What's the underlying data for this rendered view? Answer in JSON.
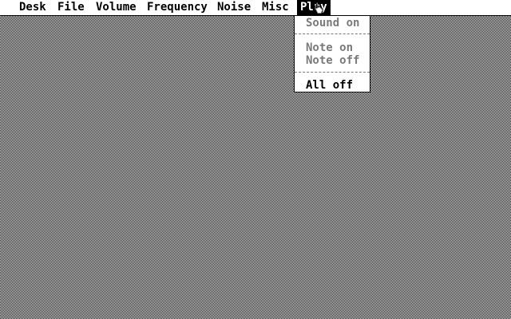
{
  "menubar": {
    "items": [
      {
        "label": "Desk"
      },
      {
        "label": "File"
      },
      {
        "label": "Volume"
      },
      {
        "label": "Frequency"
      },
      {
        "label": "Noise"
      },
      {
        "label": "Misc"
      },
      {
        "label": "Play"
      }
    ],
    "active_index": 6
  },
  "dropdown": {
    "items": [
      {
        "label": "Sound on",
        "enabled": false
      },
      {
        "label": "Note on",
        "enabled": false
      },
      {
        "label": "Note off",
        "enabled": false
      },
      {
        "label": "All off",
        "enabled": true
      }
    ]
  },
  "colors": {
    "foreground": "#000000",
    "background": "#ffffff",
    "disabled_text": "#7a7a7a"
  },
  "icons": {
    "cursor": "hand-pointer-icon"
  }
}
